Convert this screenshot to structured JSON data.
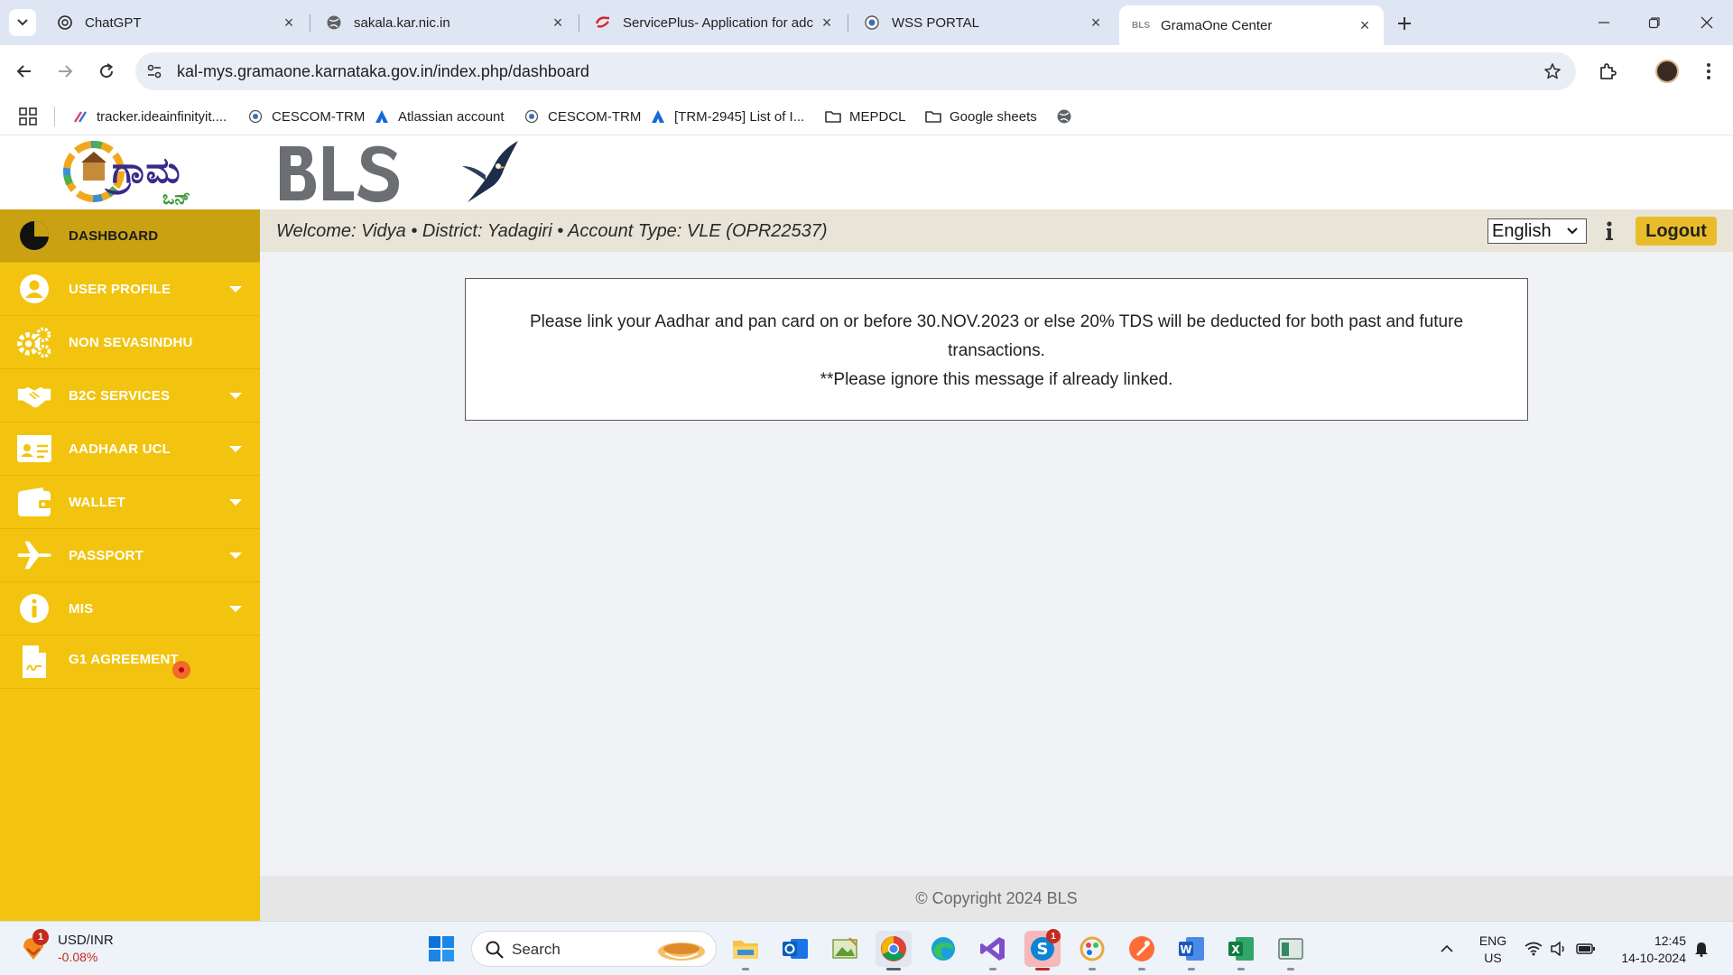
{
  "browser": {
    "tabs": [
      {
        "title": "ChatGPT",
        "active": false
      },
      {
        "title": "sakala.kar.nic.in",
        "active": false
      },
      {
        "title": "ServicePlus- Application for adc",
        "active": false
      },
      {
        "title": "WSS PORTAL",
        "active": false
      },
      {
        "title": "GramaOne Center",
        "active": true
      }
    ],
    "active_tab_favicon_text": "BLS",
    "url": "kal-mys.gramaone.karnataka.gov.in/index.php/dashboard",
    "bookmarks": [
      {
        "label": "tracker.ideainfinityit....",
        "icon": "tracker-icon"
      },
      {
        "label": "CESCOM-TRM",
        "icon": "site-icon"
      },
      {
        "label": "Atlassian account",
        "icon": "atlassian-icon"
      },
      {
        "label": "CESCOM-TRM",
        "icon": "site-icon"
      },
      {
        "label": "[TRM-2945] List of I...",
        "icon": "atlassian-icon"
      },
      {
        "label": "MEPDCL",
        "icon": "folder-icon"
      },
      {
        "label": "Google sheets",
        "icon": "folder-icon"
      }
    ]
  },
  "sidebar": {
    "items": [
      {
        "label": "DASHBOARD",
        "icon": "pie-chart-icon",
        "has_submenu": false,
        "active": true
      },
      {
        "label": "USER PROFILE",
        "icon": "user-icon",
        "has_submenu": true
      },
      {
        "label": "NON SEVASINDHU",
        "icon": "gears-icon",
        "has_submenu": false
      },
      {
        "label": "B2C SERVICES",
        "icon": "handshake-icon",
        "has_submenu": true
      },
      {
        "label": "AADHAAR UCL",
        "icon": "id-card-icon",
        "has_submenu": true
      },
      {
        "label": "WALLET",
        "icon": "wallet-icon",
        "has_submenu": true
      },
      {
        "label": "PASSPORT",
        "icon": "plane-icon",
        "has_submenu": true
      },
      {
        "label": "MIS",
        "icon": "info-icon",
        "has_submenu": true
      },
      {
        "label": "G1 AGREEMENT",
        "icon": "document-icon",
        "has_submenu": false
      }
    ]
  },
  "header": {
    "welcome": "Welcome: Vidya • District: Yadagiri • Account Type: VLE (OPR22537)",
    "language": "English",
    "logout_label": "Logout"
  },
  "notice": {
    "line1": "Please link your Aadhar and pan card on or before 30.NOV.2023 or else 20% TDS will be deducted for both past and future transactions.",
    "line2": "**Please ignore this message if already linked."
  },
  "footer": {
    "copyright": "© Copyright 2024 BLS"
  },
  "taskbar": {
    "widget_badge": "1",
    "widget_title": "USD/INR",
    "widget_value": "-0.08%",
    "search_label": "Search",
    "apps": [
      {
        "name": "file-explorer",
        "badge": ""
      },
      {
        "name": "outlook",
        "badge": ""
      },
      {
        "name": "photos",
        "badge": ""
      },
      {
        "name": "chrome",
        "badge": ""
      },
      {
        "name": "edge",
        "badge": ""
      },
      {
        "name": "visual-studio",
        "badge": ""
      },
      {
        "name": "skype",
        "badge": "1"
      },
      {
        "name": "paint",
        "badge": ""
      },
      {
        "name": "postman",
        "badge": ""
      },
      {
        "name": "word",
        "badge": ""
      },
      {
        "name": "excel",
        "badge": ""
      },
      {
        "name": "app-window",
        "badge": ""
      }
    ],
    "lang_line1": "ENG",
    "lang_line2": "US",
    "time": "12:45",
    "date": "14-10-2024"
  },
  "colors": {
    "sidebar": "#f2c40f",
    "sidebar_active": "#c9a113",
    "logout": "#e9bd2a",
    "welcome_bar": "#e8e4d7"
  }
}
